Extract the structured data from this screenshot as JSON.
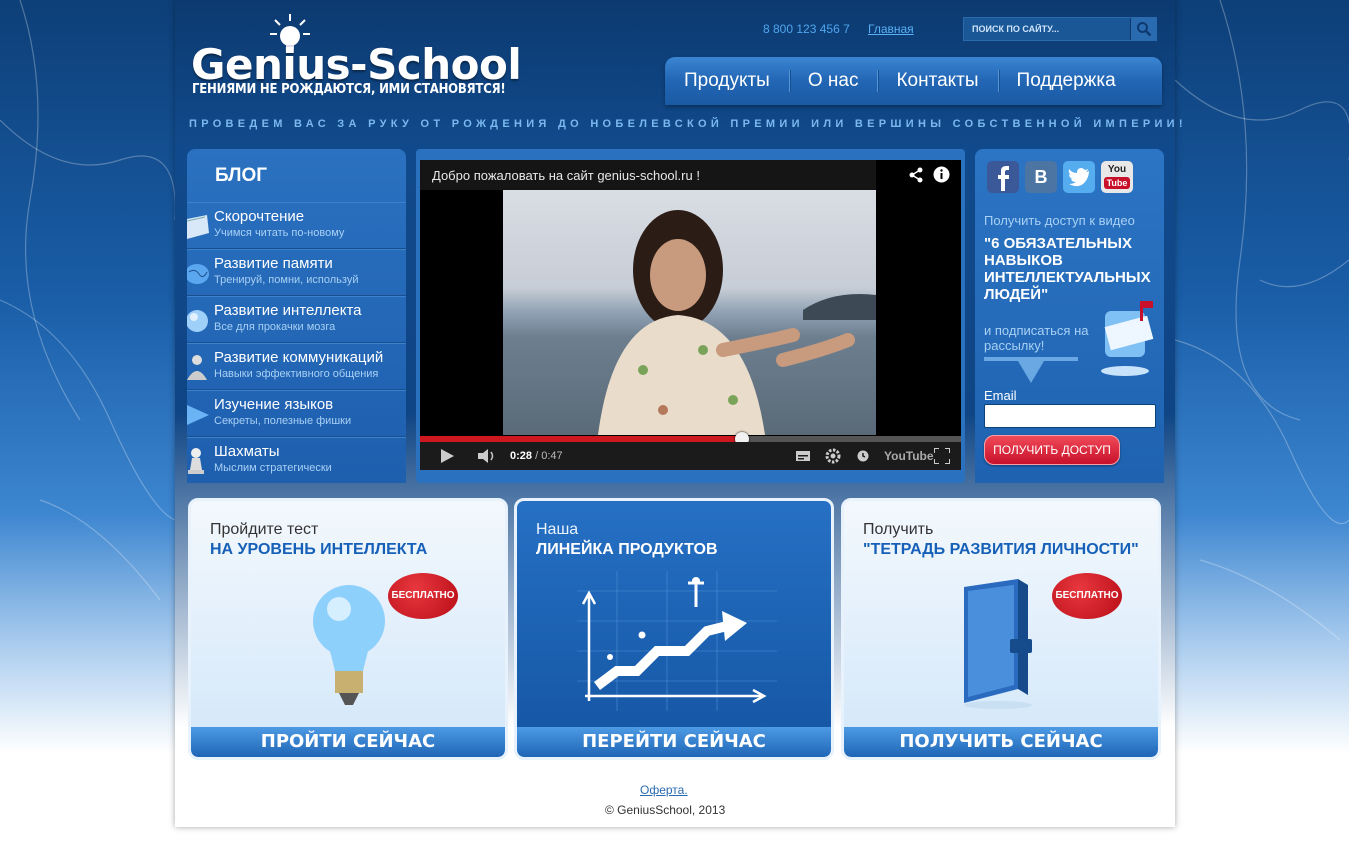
{
  "header": {
    "logo_title": "Genius-School",
    "logo_subtitle": "ГЕНИЯМИ НЕ РОЖДАЮТСЯ, ИМИ СТАНОВЯТСЯ!",
    "phone": "8 800 123 456 7",
    "home_link": "Главная",
    "search_placeholder": "ПОИСК ПО САЙТУ...",
    "tagline": "ПРОВЕДЕМ ВАС ЗА РУКУ ОТ РОЖДЕНИЯ ДО НОБЕЛЕВСКОЙ ПРЕМИИ ИЛИ ВЕРШИНЫ СОБСТВЕННОЙ ИМПЕРИИ!"
  },
  "nav": {
    "items": [
      {
        "label": "Продукты"
      },
      {
        "label": "О нас"
      },
      {
        "label": "Контакты"
      },
      {
        "label": "Поддержка"
      }
    ]
  },
  "blog": {
    "title": "БЛОГ",
    "items": [
      {
        "label": "Скорочтение",
        "sub": "Учимся читать по-новому"
      },
      {
        "label": "Развитие памяти",
        "sub": "Тренируй, помни, используй"
      },
      {
        "label": "Развитие интеллекта",
        "sub": "Все для прокачки мозга"
      },
      {
        "label": "Развитие коммуникаций",
        "sub": "Навыки эффективного общения"
      },
      {
        "label": "Изучение языков",
        "sub": "Секреты, полезные фишки"
      },
      {
        "label": "Шахматы",
        "sub": "Мыслим стратегически"
      }
    ]
  },
  "video": {
    "title": "Добро пожаловать на сайт genius-school.ru !",
    "time_current": "0:28",
    "time_total": " / 0:47",
    "progress": 0.5957,
    "brand": "YouTube"
  },
  "signup": {
    "pre": "Получить доступ к видео",
    "headline": "\"6 ОБЯЗАТЕЛЬНЫХ НАВЫКОВ ИНТЕЛЛЕКТУАЛЬНЫХ ЛЮДЕЙ\"",
    "sub": "и подписаться на рассылку!",
    "email_label": "Email",
    "email_value": "",
    "button": "ПОЛУЧИТЬ ДОСТУП",
    "social_icons": [
      "facebook-icon",
      "vkontakte-icon",
      "twitter-icon",
      "youtube-icon"
    ],
    "social_vk": "B",
    "social_yt_top": "You",
    "social_yt_bottom": "Tube"
  },
  "cards": [
    {
      "pre": "Пройдите тест",
      "title": "НА УРОВЕНЬ ИНТЕЛЛЕКТА",
      "badge": "БЕСПЛАТНО",
      "button": "ПРОЙТИ СЕЙЧАС"
    },
    {
      "pre": "Наша",
      "title": "ЛИНЕЙКА ПРОДУКТОВ",
      "badge": "",
      "button": "ПЕРЕЙТИ СЕЙЧАС"
    },
    {
      "pre": "Получить",
      "title": "\"ТЕТРАДЬ РАЗВИТИЯ ЛИЧНОСТИ\"",
      "badge": "БЕСПЛАТНО",
      "button": "ПОЛУЧИТЬ СЕЙЧАС"
    }
  ],
  "footer": {
    "offer_link": "Оферта.",
    "copyright": "© GeniusSchool, 2013"
  },
  "colors": {
    "accent": "#1660b8",
    "cta_red": "#c8102a",
    "progress_red": "#cc181e"
  }
}
